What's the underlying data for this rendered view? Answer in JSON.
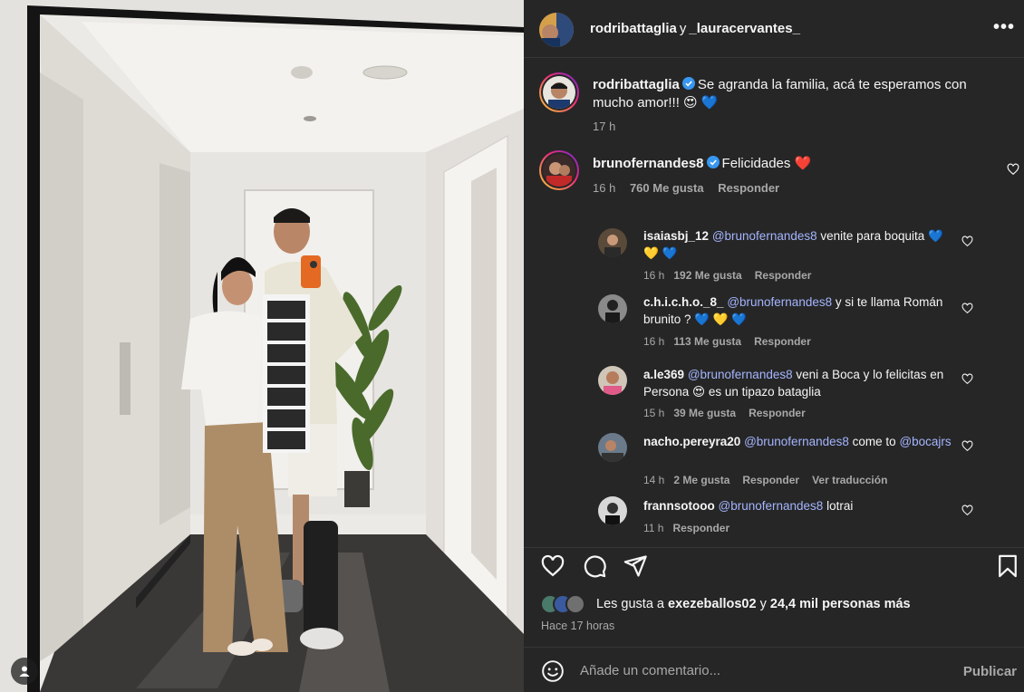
{
  "header": {
    "user1": "rodribattaglia",
    "connector": "y",
    "user2": "_lauracervantes_",
    "more_label": "•••"
  },
  "caption": {
    "user": "rodribattaglia",
    "text": "Se agranda la familia, acá te esperamos con mucho amor!!! 😍 💙",
    "time": "17 h"
  },
  "comment": {
    "user": "brunofernandes8",
    "text": "Felicidades ❤️",
    "time": "16 h",
    "likes": "760 Me gusta",
    "reply": "Responder"
  },
  "replies": [
    {
      "user": "isaiasbj_12",
      "mention": "@brunofernandes8",
      "text": "venite para boquita 💙 💛 💙",
      "time": "16 h",
      "likes": "192 Me gusta",
      "reply": "Responder"
    },
    {
      "user": "c.h.i.c.h.o._8_",
      "mention": "@brunofernandes8",
      "text": "y si te llama Román brunito ? 💙 💛 💙",
      "time": "16 h",
      "likes": "113 Me gusta",
      "reply": "Responder"
    },
    {
      "user": "a.le369",
      "mention": "@brunofernandes8",
      "text": "veni a Boca y lo felicitas en Persona 😍 es un tipazo bataglia",
      "time": "15 h",
      "likes": "39 Me gusta",
      "reply": "Responder"
    },
    {
      "user": "nacho.pereyra20",
      "mention": "@brunofernandes8",
      "text": "come to",
      "mention2": "@bocajrs",
      "time": "14 h",
      "likes": "2 Me gusta",
      "reply": "Responder",
      "translate": "Ver traducción"
    },
    {
      "user": "frannsotooo",
      "mention": "@brunofernandes8",
      "text": "lotrai",
      "time": "11 h",
      "reply": "Responder"
    }
  ],
  "likes_line": {
    "prefix": "Les gusta a",
    "user": "exezeballos02",
    "connector": "y",
    "others": "24,4 mil personas más"
  },
  "posted_ago": "Hace 17 horas",
  "composer": {
    "placeholder": "Añade un comentario...",
    "publish": "Publicar"
  },
  "colors": {
    "panel_bg": "#262626",
    "mention": "#a4b5ff",
    "secondary_text": "#a8a8a8",
    "verified": "#3897f0",
    "heart_red": "#ff3040"
  },
  "icons": [
    "more-icon",
    "verified-icon",
    "heart-icon",
    "comment-icon",
    "share-icon",
    "bookmark-icon",
    "emoji-icon",
    "user-tag-icon"
  ]
}
